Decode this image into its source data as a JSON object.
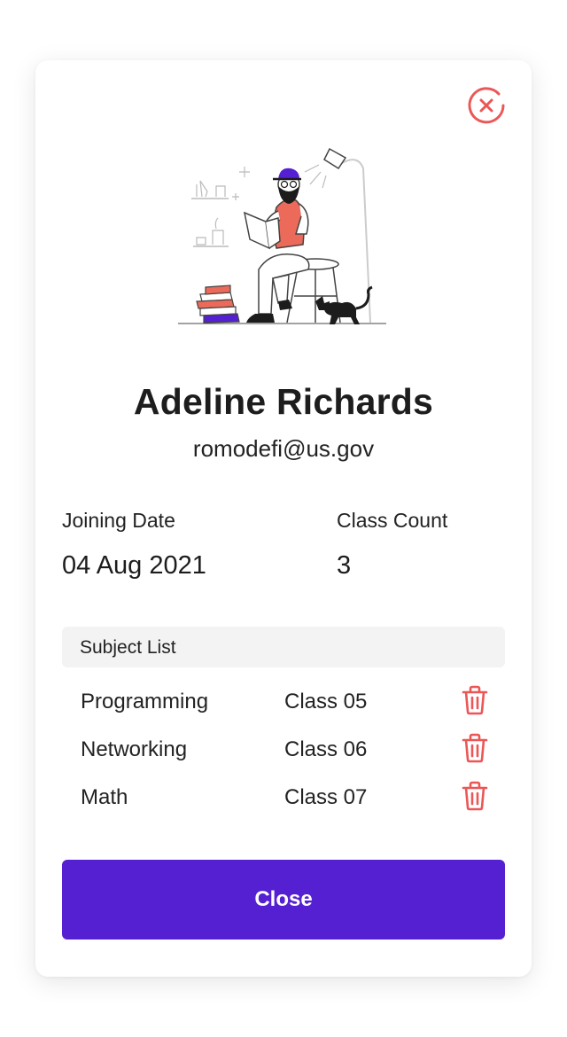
{
  "profile": {
    "name": "Adeline Richards",
    "email": "romodefi@us.gov"
  },
  "stats": {
    "joining_label": "Joining Date",
    "joining_value": "04 Aug 2021",
    "class_count_label": "Class Count",
    "class_count_value": "3"
  },
  "subjects": {
    "header": "Subject List",
    "items": [
      {
        "subject": "Programming",
        "class": "Class 05"
      },
      {
        "subject": "Networking",
        "class": "Class 06"
      },
      {
        "subject": "Math",
        "class": "Class 07"
      }
    ]
  },
  "actions": {
    "close_label": "Close"
  },
  "icons": {
    "dismiss": "close-circle-icon",
    "delete": "trash-icon"
  },
  "colors": {
    "accent": "#5420d2",
    "danger": "#eb5757",
    "header_bg": "#f3f3f3"
  }
}
